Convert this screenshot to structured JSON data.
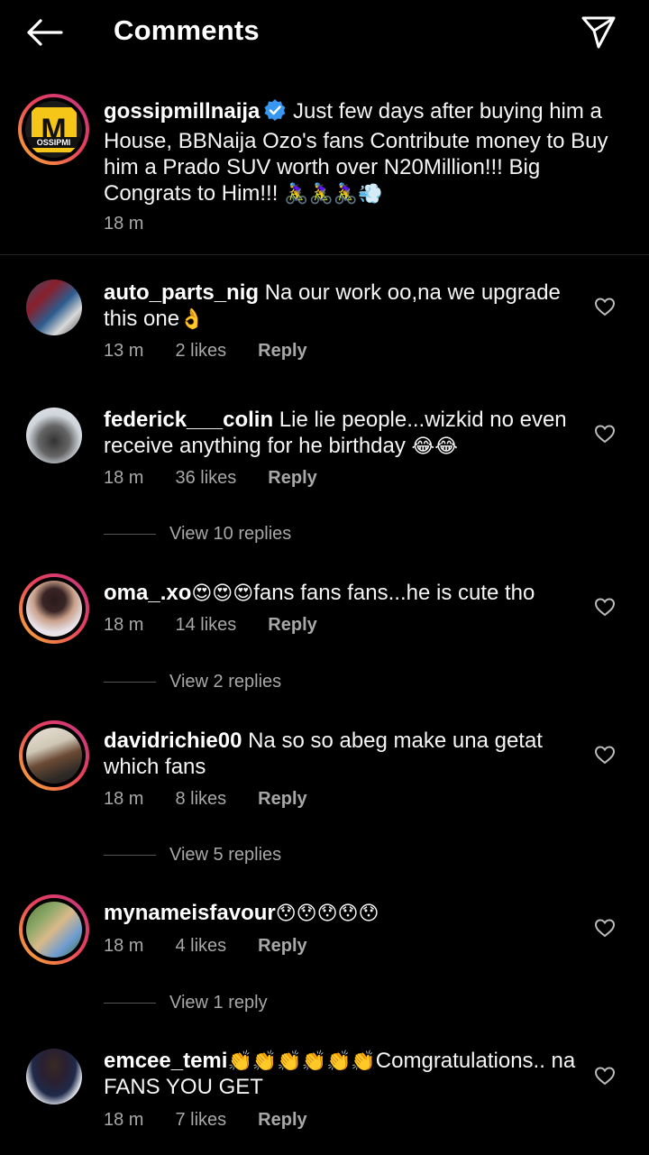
{
  "header": {
    "title": "Comments",
    "back_icon": "arrow-left-icon",
    "share_icon": "paper-plane-icon"
  },
  "caption": {
    "username": "gossipmillnaija",
    "verified": true,
    "text": " Just few days after buying him a House, BBNaija Ozo's fans Contribute money to Buy him a Prado SUV worth over N20Million!!! Big Congrats to Him!!! ",
    "emojis": "🚴‍♀️🚴‍♀️🚴‍♀️💨",
    "time": "18 m",
    "avatar_letter": "M",
    "avatar_label": "OSSIPMI"
  },
  "comments": [
    {
      "username": "auto_parts_nig",
      "text": " Na our work oo,na we upgrade this one",
      "emoji": "👌",
      "time": "13 m",
      "likes": "2 likes",
      "reply": "Reply"
    },
    {
      "username": "federick___colin",
      "text": " Lie lie people...wizkid no even receive anything for he birthday ",
      "emoji": "😂😂",
      "time": "18 m",
      "likes": "36 likes",
      "reply": "Reply",
      "view_replies": "View 10 replies"
    },
    {
      "username": "oma_.xo",
      "text": "fans fans fans...he is cute tho",
      "emoji_pre": " 😍😍😍",
      "time": "18 m",
      "likes": "14 likes",
      "reply": "Reply",
      "view_replies": "View 2 replies"
    },
    {
      "username": "davidrichie00",
      "text": " Na so so abeg make una getat which fans",
      "time": "18 m",
      "likes": "8 likes",
      "reply": "Reply",
      "view_replies": "View 5 replies"
    },
    {
      "username": "mynameisfavour",
      "emoji": " 😯😯😯😯😯",
      "time": "18 m",
      "likes": "4 likes",
      "reply": "Reply",
      "view_replies": "View 1 reply"
    },
    {
      "username": "emcee_temi",
      "emoji_pre": " 👏👏👏👏👏👏",
      "text": "Comgratulations.. na FANS YOU GET",
      "time": "18 m",
      "likes": "7 likes",
      "reply": "Reply"
    }
  ]
}
